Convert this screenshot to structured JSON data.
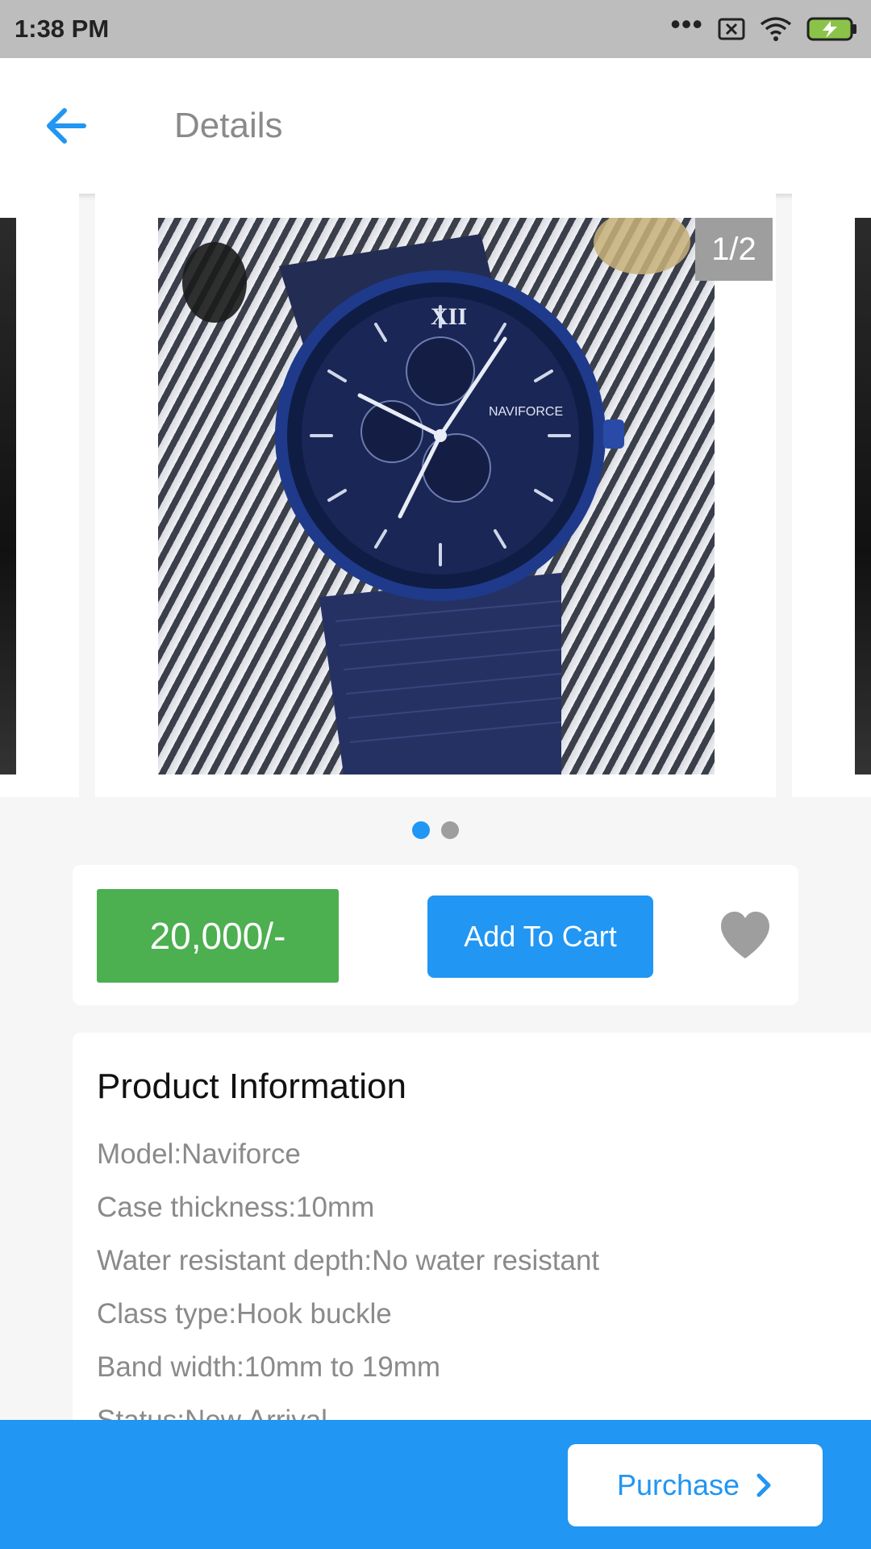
{
  "status_bar": {
    "time": "1:38 PM",
    "icons": [
      "more-dots-icon",
      "sim-blocked-icon",
      "wifi-icon",
      "battery-charging-icon"
    ],
    "dots": "•••"
  },
  "app_bar": {
    "title": "Details",
    "back_icon": "arrow-left-icon"
  },
  "carousel": {
    "counter": "1/2",
    "total_pages": 2,
    "active_index": 0,
    "photo_brand": "NAVIFORCE"
  },
  "actions": {
    "price": "20,000/-",
    "add_to_cart_label": "Add To Cart",
    "favorite_icon": "heart-icon"
  },
  "product_info": {
    "title": "Product Information",
    "items": [
      "Model:Naviforce",
      "Case thickness:10mm",
      "Water resistant depth:No water resistant",
      "Class type:Hook buckle",
      "Band width:10mm to 19mm",
      "Status:New Arrival"
    ]
  },
  "bottom_bar": {
    "purchase_label": "Purchase",
    "purchase_icon": "chevron-right-icon"
  },
  "colors": {
    "accent": "#2196f3",
    "price_green": "#4caf50",
    "status_bar": "#bdbdbd",
    "muted_text": "#8a8a8a"
  }
}
